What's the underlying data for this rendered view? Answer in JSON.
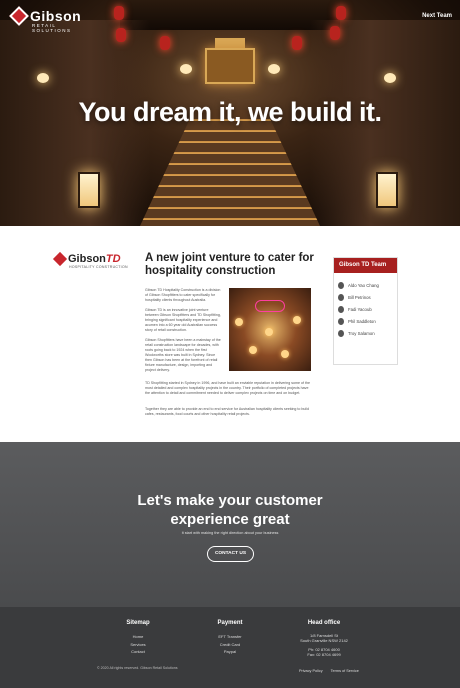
{
  "header": {
    "logo_name": "Gibson",
    "logo_sub": "RETAIL SOLUTIONS",
    "nav_link": "Next Team",
    "hero_title": "You dream it, we build it."
  },
  "main": {
    "td_logo": {
      "name": "Gibson",
      "suffix": "TD",
      "tagline": "HOSPITALITY CONSTRUCTION"
    },
    "title": "A new joint venture to cater for hospitality construction",
    "paragraphs": [
      "Gibson TD Hospitality Construction is a division of Gibson Shopfitters to cater specifically for hospitality clients throughout Australia.",
      "Gibson TD is an innovative joint venture between Gibson Shopfitters and TD Shopfitting, bringing significant hospitality experience and acumen into a 60 year old Australian success story of retail construction.",
      "Gibson Shopfitters have been a mainstay of the retail construction landscape for decades, with roots going back to 1924 when the first Woolworths store was built in Sydney. Since then Gibson has been at the forefront of retail fixture manufacture, design, importing and project delivery.",
      "TD Shopfitting started in Sydney in 1996, and have built an enviable reputation in delivering some of the most detailed and complex hospitality projects in the country. Their portfolio of completed projects have the attention to detail and commitment needed to deliver complex projects on time and on budget.",
      "Together they are able to provide an end to end service for Australian hospitality clients seeking to build cafes, restaurants, food courts and other hospitality retail projects."
    ]
  },
  "team": {
    "heading": "Gibson TD Team",
    "members": [
      "Aldo Yao Chang",
      "Bill Petrinos",
      "Fadi Yacoub",
      "Phil Saddleton",
      "Troy Salamon"
    ]
  },
  "cta": {
    "title_line1": "Let's make your customer",
    "title_line2": "experience great",
    "subtitle": "It start with making the right direction about your business",
    "button": "CONTACT US"
  },
  "footer": {
    "sitemap": {
      "heading": "Sitemap",
      "items": [
        "Home",
        "Services",
        "Contact"
      ]
    },
    "payment": {
      "heading": "Payment",
      "items": [
        "EFT Transfer",
        "Credit Card",
        "Paypal"
      ]
    },
    "office": {
      "heading": "Head office",
      "lines": [
        "1/8 Farnsdell St",
        "South Granville NSW 2142",
        "Ph: 02 8704 4600",
        "Fax: 02 8704 4699"
      ]
    },
    "copyright": "© 2020 All rights reserved. Gibson Retail Solutions",
    "legal": [
      "Privacy Policy",
      "Terms of Service"
    ]
  },
  "colors": {
    "brand_red": "#c8262d",
    "team_header": "#a7201f",
    "cta_bg": "#545557",
    "footer_bg": "#3a3b3d"
  },
  "icons": {
    "logo": "diamond-mark-icon",
    "avatar": "person-avatar-icon"
  }
}
